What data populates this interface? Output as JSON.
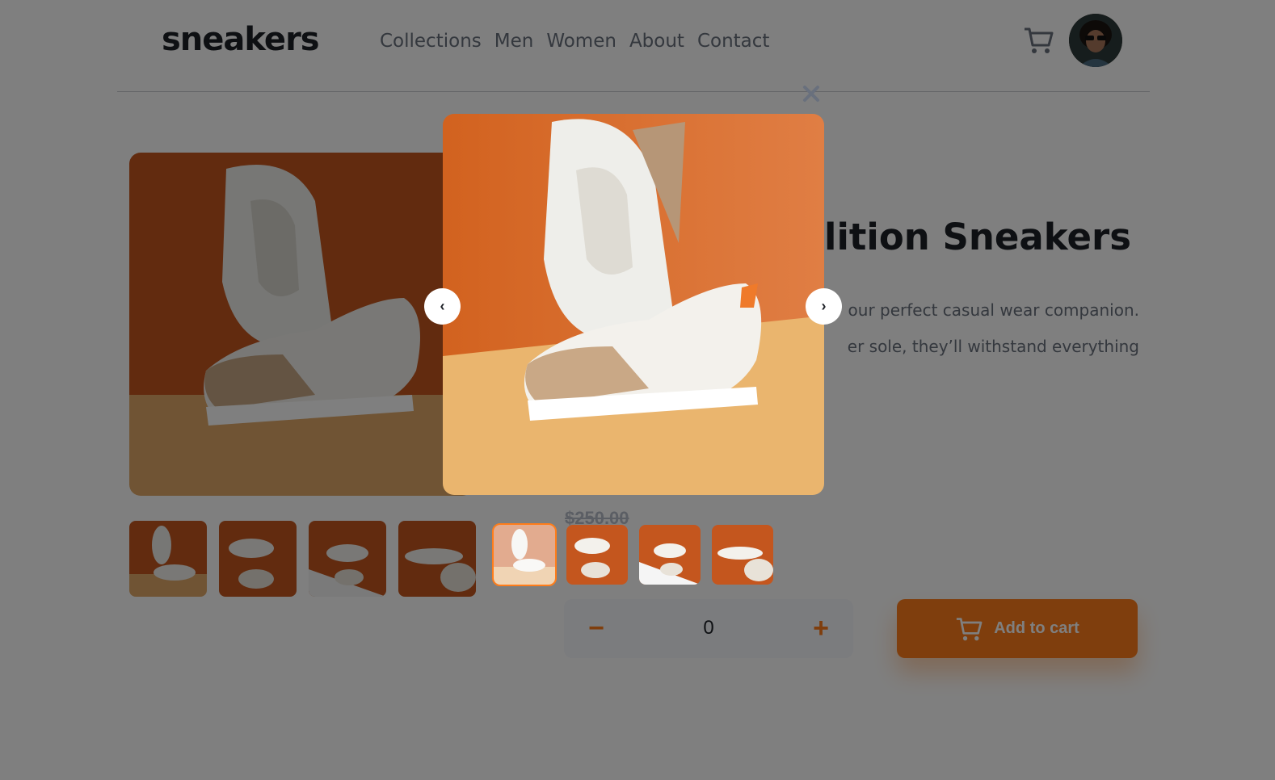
{
  "brand": {
    "logo": "sneakers",
    "accent": "#ff7d1a"
  },
  "nav": {
    "items": [
      "Collections",
      "Men",
      "Women",
      "About",
      "Contact"
    ]
  },
  "header": {
    "cart_icon": "cart-icon",
    "avatar": "user-avatar"
  },
  "product": {
    "company": "",
    "title_visible": "lition Sneakers",
    "description_line1": "our perfect casual wear companion.",
    "description_line2": "er sole, they’ll withstand everything",
    "price_old": "$250.00"
  },
  "quantity": {
    "minus": "−",
    "value": "0",
    "plus": "+"
  },
  "cart_button": {
    "label": "Add to cart"
  },
  "lightbox": {
    "close_icon": "close-icon",
    "prev": "‹",
    "next": "›",
    "active_thumb": 1
  }
}
